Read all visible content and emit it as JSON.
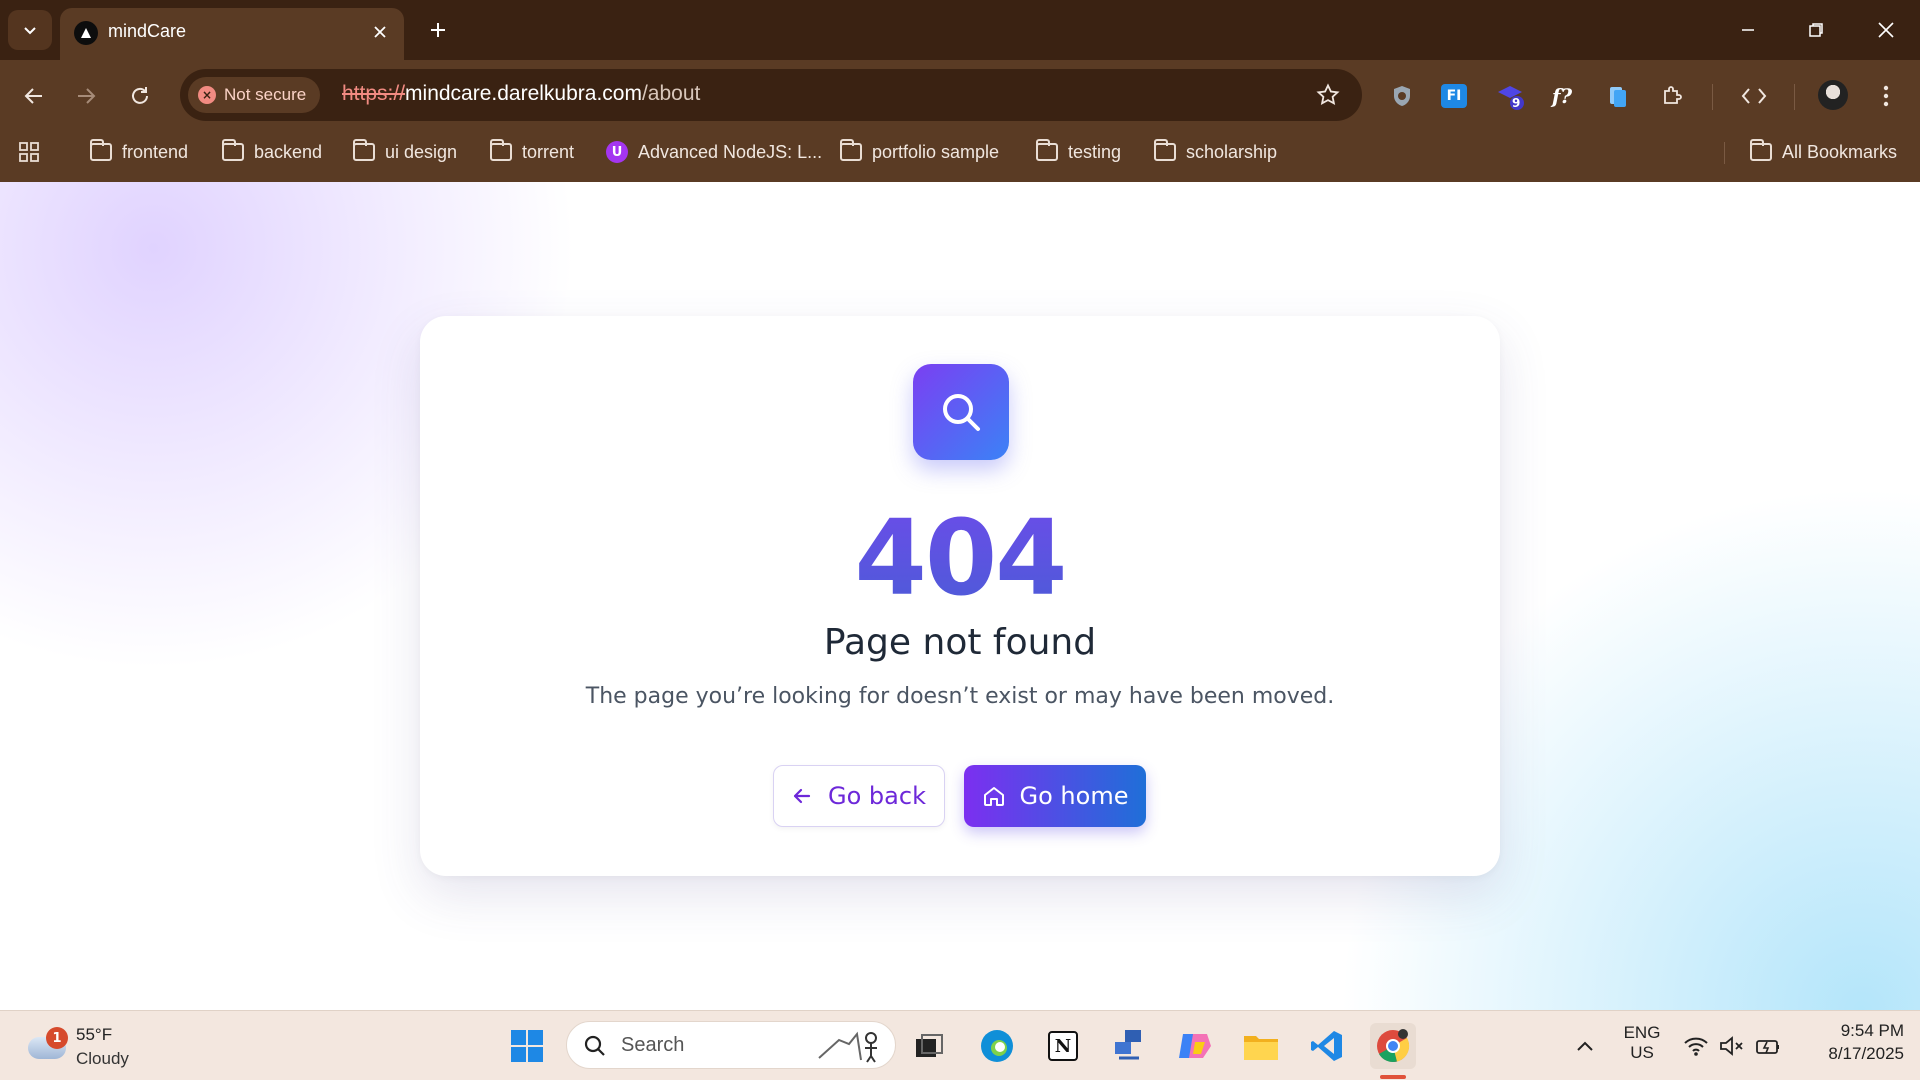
{
  "browser": {
    "tab_title": "mindCare",
    "security_label": "Not secure",
    "url_scheme": "https://",
    "url_host": "mindcare.darelkubra.com",
    "url_path": "/about",
    "extension_badge": "9",
    "bookmarks": [
      "frontend",
      "backend",
      "ui design",
      "torrent",
      "Advanced NodeJS: L...",
      "portfolio sample",
      "testing",
      "scholarship"
    ],
    "all_bookmarks": "All Bookmarks",
    "accent": "#5a3b24"
  },
  "page": {
    "error_code": "404",
    "heading": "Page not found",
    "message": "The page you’re looking for doesn’t exist or may have been moved.",
    "back_label": "Go back",
    "home_label": "Go home",
    "primary_gradient": [
      "#7c2ff0",
      "#1f6fd8"
    ]
  },
  "taskbar": {
    "weather_badge": "1",
    "weather_temp": "55°F",
    "weather_condition": "Cloudy",
    "search_placeholder": "Search",
    "lang_top": "ENG",
    "lang_bottom": "US",
    "time": "9:54 PM",
    "date": "8/17/2025"
  }
}
